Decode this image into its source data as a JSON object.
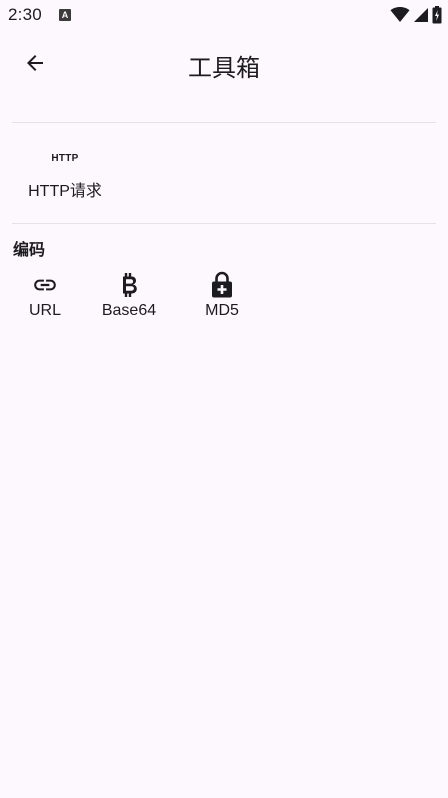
{
  "status_bar": {
    "time": "2:30",
    "app_icon_letter": "A",
    "icons": [
      "wifi-icon",
      "cell-signal-icon",
      "battery-charging-icon"
    ]
  },
  "app_bar": {
    "back_icon": "arrow-back-icon",
    "title": "工具箱"
  },
  "tools": {
    "http": {
      "glyph": "HTTP",
      "label": "HTTP请求"
    }
  },
  "encoding": {
    "section_title": "编码",
    "items": [
      {
        "icon": "link-icon",
        "label": "URL"
      },
      {
        "icon": "bitcoin-icon",
        "label": "Base64"
      },
      {
        "icon": "lock-add-icon",
        "label": "MD5"
      }
    ]
  }
}
